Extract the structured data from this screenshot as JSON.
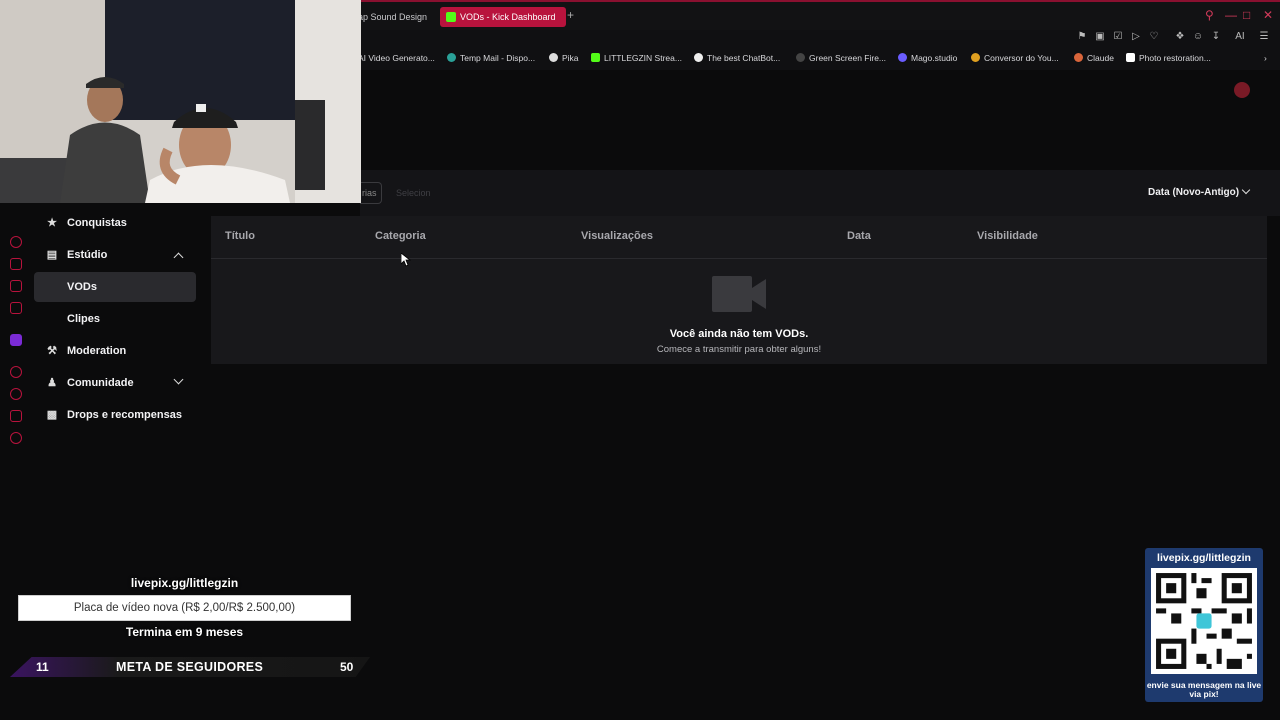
{
  "browser": {
    "tabs": [
      {
        "label": "ap Sound Design",
        "active": false
      },
      {
        "label": "VODs - Kick Dashboard",
        "active": true
      }
    ],
    "new_tab": "+",
    "ai_label": "AI",
    "bookmarks": [
      "AI Video Generato...",
      "Temp Mail - Dispo...",
      "Pika",
      "LITTLEGZIN Strea...",
      "The best ChatBot...",
      "Green Screen Fire...",
      "Mago.studio",
      "Conversor do You...",
      "Claude",
      "Photo restoration..."
    ],
    "accent": "#b8133d"
  },
  "toolbar": {
    "search_fragment": "rias",
    "filter_fragment": "Selecion",
    "sort_label": "Data (Novo-Antigo)"
  },
  "table": {
    "columns": [
      "Título",
      "Categoria",
      "Visualizações",
      "Data",
      "Visibilidade"
    ],
    "empty_title": "Você ainda não tem VODs.",
    "empty_subtitle": "Comece a transmitir para obter alguns!"
  },
  "sidebar": {
    "items": [
      {
        "label": "Conquistas",
        "icon": "trophy-icon"
      },
      {
        "label": "Estúdio",
        "icon": "studio-icon",
        "expanded": true
      },
      {
        "label": "VODs",
        "sub": true,
        "active": true
      },
      {
        "label": "Clipes",
        "sub": true
      },
      {
        "label": "Moderation",
        "icon": "wrench-icon"
      },
      {
        "label": "Comunidade",
        "icon": "community-icon",
        "expanded": false
      },
      {
        "label": "Drops e recompensas",
        "icon": "gift-icon"
      }
    ]
  },
  "overlay": {
    "livepix_url": "livepix.gg/littlegzin",
    "goal_text": "Placa de vídeo nova (R$ 2,00/R$ 2.500,00)",
    "goal_ends": "Termina em 9 meses",
    "followers": {
      "current": "11",
      "label": "META DE SEGUIDORES",
      "target": "50"
    },
    "qr_title": "livepix.gg/littlegzin",
    "qr_message": "envie sua mensagem na live via pix!"
  }
}
